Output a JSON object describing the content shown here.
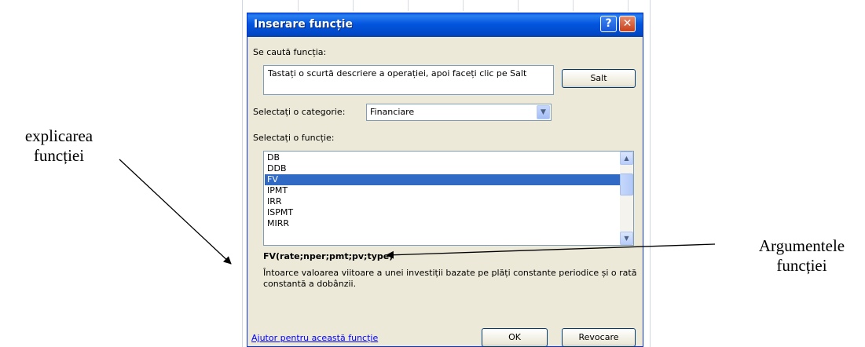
{
  "annotations": {
    "left": [
      "explicarea",
      "funcției"
    ],
    "right": [
      "Argumentele",
      "funcției"
    ]
  },
  "dialog": {
    "title": "Inserare funcție",
    "help_button": "?",
    "close_button": "✕",
    "search_label": "Se caută funcția:",
    "search_value": "Tastați o scurtă descriere a operației, apoi faceți clic pe Salt",
    "go_button": "Salt",
    "category_label": "Selectați o categorie:",
    "category_value": "Financiare",
    "function_list_label": "Selectați o funcție:",
    "functions": [
      "DB",
      "DDB",
      "FV",
      "IPMT",
      "IRR",
      "ISPMT",
      "MIRR"
    ],
    "selected_function": "FV",
    "syntax": "FV(rate;nper;pmt;pv;type)",
    "description": "Întoarce valoarea viitoare a unei investiții bazate pe plăți constante periodice și o rată constantă a dobânzii.",
    "help_link": "Ajutor pentru această funcție",
    "ok_button": "OK",
    "cancel_button": "Revocare"
  },
  "icons": {
    "dropdown": "chevron-down-icon",
    "scroll_up": "arrow-up-icon",
    "scroll_down": "arrow-down-icon"
  },
  "colors": {
    "titlebar": "#0355de",
    "dialog_bg": "#ece9d8",
    "selection": "#316ac5",
    "link": "#0000ff"
  }
}
